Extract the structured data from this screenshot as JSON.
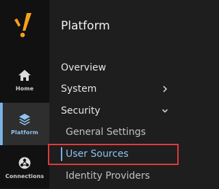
{
  "rail": {
    "logo_icon": "ignition-logo-icon",
    "items": [
      {
        "label": "Home",
        "icon": "home-icon"
      },
      {
        "label": "Platform",
        "icon": "layers-icon",
        "active": true
      },
      {
        "label": "Connections",
        "icon": "connections-icon"
      }
    ]
  },
  "panel": {
    "title": "Platform",
    "items": [
      {
        "label": "Overview"
      },
      {
        "label": "System",
        "chevron": "chevron-right-icon"
      },
      {
        "label": "Security",
        "chevron": "chevron-down-icon",
        "expanded": true
      },
      {
        "label": "General Settings"
      },
      {
        "label": "User Sources",
        "selected": true
      },
      {
        "label": "Identity Providers"
      }
    ]
  },
  "colors": {
    "background": "#1e1e1e",
    "rail_background": "#111111",
    "accent": "#7ab2e6",
    "logo": "#f5a11b",
    "highlight": "#e23b3b"
  }
}
